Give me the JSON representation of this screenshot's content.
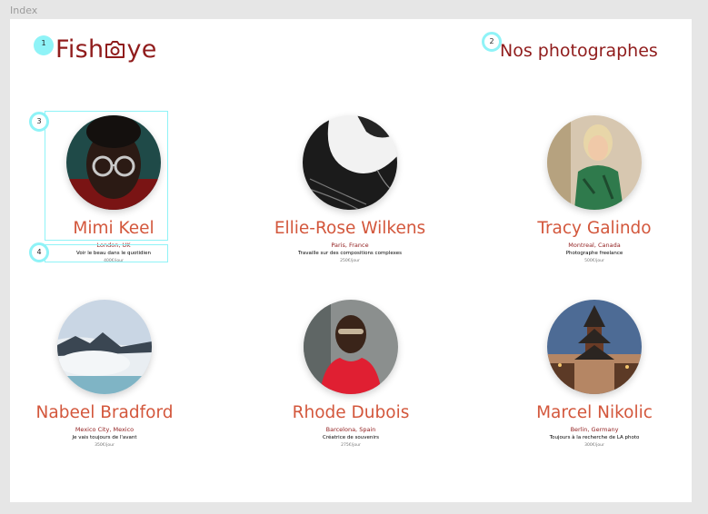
{
  "frame": {
    "label": "Index"
  },
  "header": {
    "logo_text_start": "Fish",
    "logo_text_end": "ye",
    "heading": "Nos photographes"
  },
  "annotations": [
    "1",
    "2",
    "3",
    "4"
  ],
  "photographers": [
    {
      "name": "Mimi Keel",
      "location": "London, UK",
      "tagline": "Voir le beau dans le quotidien",
      "price": "400€/jour",
      "portrait": "portrait-woman-glasses"
    },
    {
      "name": "Ellie-Rose Wilkens",
      "location": "Paris, France",
      "tagline": "Travaille sur des compositions complexes",
      "price": "250€/jour",
      "portrait": "architecture-abstract"
    },
    {
      "name": "Tracy Galindo",
      "location": "Montreal, Canada",
      "tagline": "Photographe freelance",
      "price": "500€/jour",
      "portrait": "fashion-portrait"
    },
    {
      "name": "Nabeel Bradford",
      "location": "Mexico City, Mexico",
      "tagline": "Je vais toujours de l'avant",
      "price": "350€/jour",
      "portrait": "snowy-landscape"
    },
    {
      "name": "Rhode Dubois",
      "location": "Barcelona, Spain",
      "tagline": "Créatrice de souvenirs",
      "price": "275€/jour",
      "portrait": "woman-red-dress"
    },
    {
      "name": "Marcel Nikolic",
      "location": "Berlin, Germany",
      "tagline": "Toujours à la recherche de LA photo",
      "price": "300€/jour",
      "portrait": "pagoda-street"
    }
  ],
  "colors": {
    "brand": "#901c1c",
    "name": "#d3573c",
    "annotation": "#8ff3f7",
    "canvas": "#e6e6e6"
  }
}
